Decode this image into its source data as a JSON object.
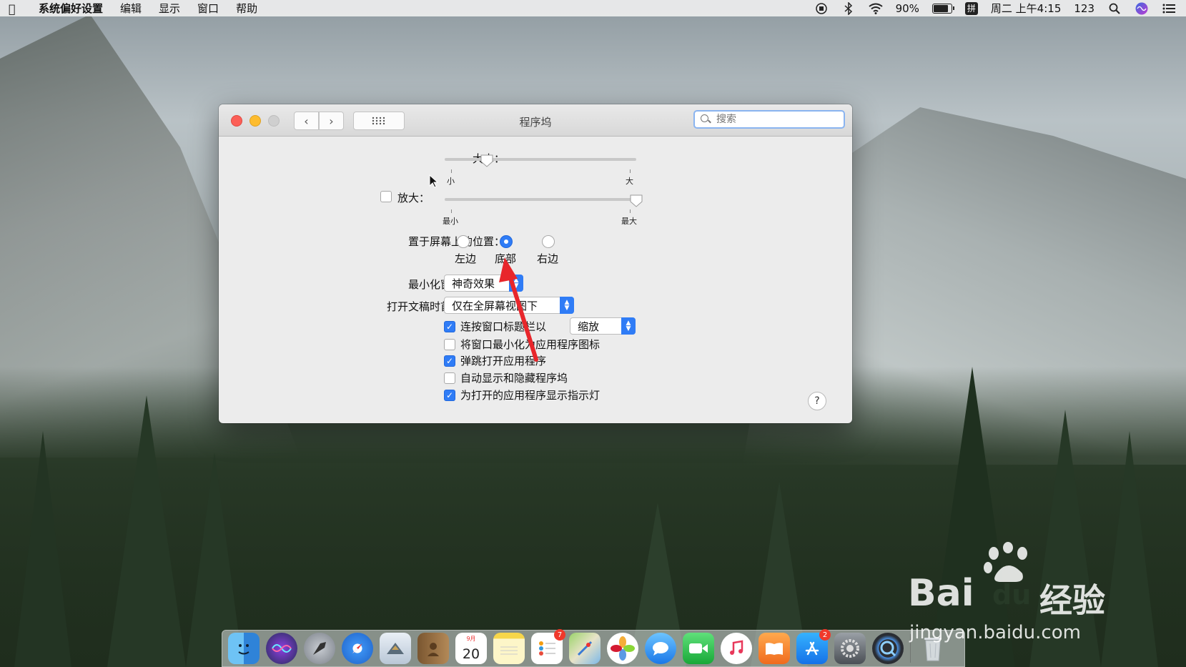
{
  "menubar": {
    "app_name": "系统偏好设置",
    "menus": [
      "编辑",
      "显示",
      "窗口",
      "帮助"
    ],
    "battery_percent": "90%",
    "ime": "拼",
    "datetime": "周二 上午4:15",
    "user": "123"
  },
  "window": {
    "title": "程序坞",
    "search_placeholder": "搜索"
  },
  "settings": {
    "size_label": "大小：",
    "size_min_label": "小",
    "size_max_label": "大",
    "size_value_fraction": 0.22,
    "magnify_label": "放大：",
    "magnify_checked": false,
    "magnify_min_label": "最小",
    "magnify_max_label": "最大",
    "magnify_value_fraction": 1.0,
    "position_label": "置于屏幕上的位置：",
    "position_options": [
      "左边",
      "底部",
      "右边"
    ],
    "position_selected": "底部",
    "minimize_label": "最小化窗口时使用：",
    "minimize_value": "神奇效果",
    "tabs_label": "打开文稿时首选标签页：",
    "tabs_value": "仅在全屏幕视图下",
    "double_click_label": "连按窗口标题栏以",
    "double_click_checked": true,
    "double_click_value": "缩放",
    "minimize_to_icon_label": "将窗口最小化为应用程序图标",
    "minimize_to_icon_checked": false,
    "animate_label": "弹跳打开应用程序",
    "animate_checked": true,
    "autohide_label": "自动显示和隐藏程序坞",
    "autohide_checked": false,
    "indicators_label": "为打开的应用程序显示指示灯",
    "indicators_checked": true,
    "help": "?"
  },
  "dock": {
    "calendar_month": "9月",
    "calendar_day": "20",
    "reminders_badge": "7",
    "appstore_badge": "2",
    "icons": [
      "finder-icon",
      "siri-icon",
      "launchpad-icon",
      "safari-icon",
      "mail-icon",
      "contacts-icon",
      "calendar-icon",
      "notes-icon",
      "reminders-icon",
      "maps-icon",
      "photos-icon",
      "messages-icon",
      "facetime-icon",
      "music-icon",
      "books-icon",
      "appstore-icon",
      "system-preferences-icon",
      "quicktime-icon",
      "trash-icon"
    ]
  },
  "watermark": {
    "brand_a": "Bai",
    "brand_b": "du",
    "brand_c": "经验",
    "url": "jingyan.baidu.com"
  },
  "colors": {
    "accent": "#2f7cf6",
    "annotation": "#e8262b"
  }
}
